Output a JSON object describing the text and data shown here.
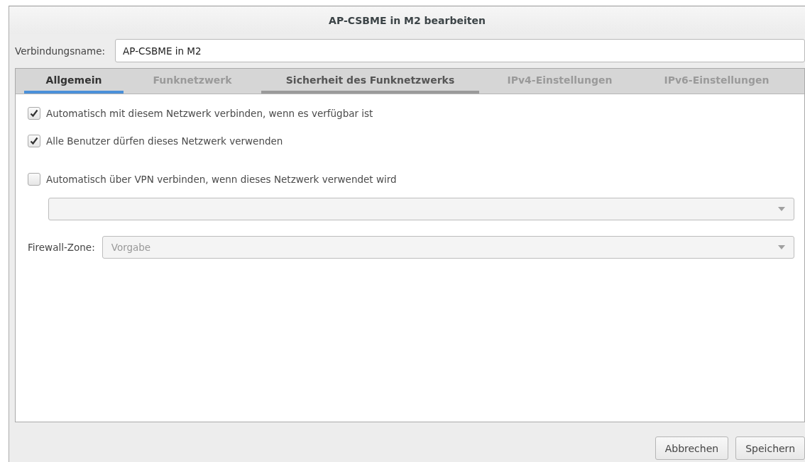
{
  "window": {
    "title": "AP-CSBME in M2 bearbeiten"
  },
  "connection_name": {
    "label": "Verbindungsname:",
    "value": "AP-CSBME in M2"
  },
  "tabs": [
    {
      "label": "Allgemein",
      "selected": true,
      "dimmed": false,
      "hovered": false
    },
    {
      "label": "Funknetzwerk",
      "selected": false,
      "dimmed": true,
      "hovered": false
    },
    {
      "label": "Sicherheit des Funknetzwerks",
      "selected": false,
      "dimmed": false,
      "hovered": true
    },
    {
      "label": "IPv4-Einstellungen",
      "selected": false,
      "dimmed": true,
      "hovered": false
    },
    {
      "label": "IPv6-Einstellungen",
      "selected": false,
      "dimmed": true,
      "hovered": false
    }
  ],
  "options": [
    {
      "label": "Automatisch mit diesem Netzwerk verbinden, wenn es verfügbar ist",
      "checked": true
    },
    {
      "label": "Alle Benutzer dürfen dieses Netzwerk verwenden",
      "checked": true
    },
    {
      "label": "Automatisch über VPN verbinden, wenn dieses Netzwerk verwendet wird",
      "checked": false
    }
  ],
  "vpn_dropdown": {
    "disabled": true
  },
  "firewall_zone": {
    "label": "Firewall-Zone:",
    "value": "Vorgabe",
    "disabled": true
  },
  "buttons": [
    "Abbrechen",
    "Speichern"
  ]
}
